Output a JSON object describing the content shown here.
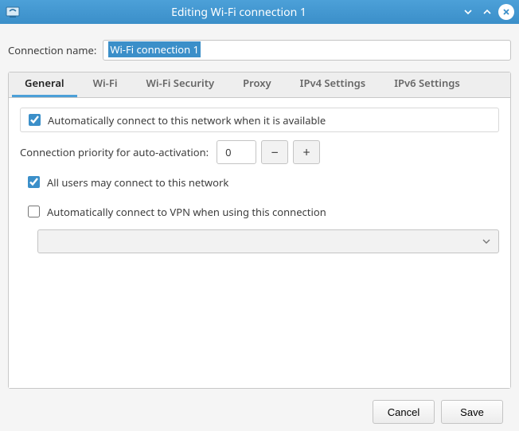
{
  "window": {
    "title": "Editing Wi-Fi connection 1"
  },
  "form": {
    "name_label": "Connection name:",
    "name_value": "Wi-Fi connection 1"
  },
  "tabs": [
    {
      "label": "General",
      "active": true
    },
    {
      "label": "Wi-Fi",
      "active": false
    },
    {
      "label": "Wi-Fi Security",
      "active": false
    },
    {
      "label": "Proxy",
      "active": false
    },
    {
      "label": "IPv4 Settings",
      "active": false
    },
    {
      "label": "IPv6 Settings",
      "active": false
    }
  ],
  "general": {
    "auto_connect_label": "Automatically connect to this network when it is available",
    "auto_connect_checked": true,
    "priority_label": "Connection priority for auto-activation:",
    "priority_value": "0",
    "all_users_label": "All users may connect to this network",
    "all_users_checked": true,
    "vpn_label": "Automatically connect to VPN when using this connection",
    "vpn_checked": false,
    "vpn_selected": ""
  },
  "footer": {
    "cancel": "Cancel",
    "save": "Save"
  }
}
